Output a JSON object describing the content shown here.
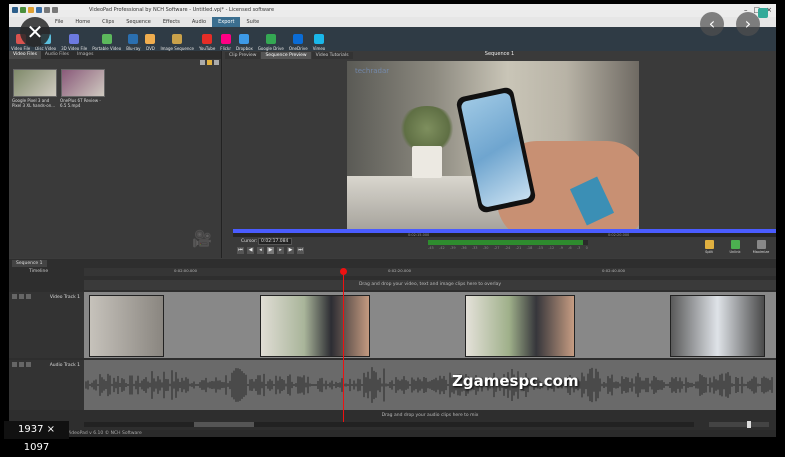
{
  "titlebar": {
    "title": "VideoPad Professional by NCH Software - Untitled.vpj* - Licensed software"
  },
  "menu": [
    "File",
    "Home",
    "Clips",
    "Sequence",
    "Effects",
    "Audio",
    "Export",
    "Suite"
  ],
  "menu_active_index": 6,
  "ribbon": [
    {
      "label": "Video File",
      "color": "#d9534f"
    },
    {
      "label": "Disc Video",
      "color": "#5bc0de"
    },
    {
      "label": "3D Video File",
      "color": "#6c7ae0"
    },
    {
      "label": "Portable Video",
      "color": "#5cb85c"
    },
    {
      "label": "Blu-ray",
      "color": "#2a6fb0"
    },
    {
      "label": "DVD",
      "color": "#f0ad4e"
    },
    {
      "label": "Image Sequence",
      "color": "#c9a14a"
    },
    {
      "label": "YouTube",
      "color": "#e52d27"
    },
    {
      "label": "Flickr",
      "color": "#ff0084"
    },
    {
      "label": "Dropbox",
      "color": "#3d9ae8"
    },
    {
      "label": "Google Drive",
      "color": "#34a853"
    },
    {
      "label": "OneDrive",
      "color": "#0a6cd6"
    },
    {
      "label": "Vimeo",
      "color": "#1ab7ea"
    }
  ],
  "nch_suite": "NCH Suite",
  "media": {
    "tabs": [
      "Video Files",
      "Audio Files",
      "Images"
    ],
    "clips": [
      {
        "label": "Google Pixel 3 and Pixel 3 XL hands-on...",
        "color": "#7f8a6a"
      },
      {
        "label": "OnePlus 6T Review - 6.5 5.mp4",
        "color": "#8a5a7a"
      }
    ]
  },
  "preview": {
    "tabs": [
      "Clip Preview",
      "Sequence Preview",
      "Video Tutorials"
    ],
    "sequence_title": "Sequence 1",
    "watermark": "techradar",
    "ruler_ticks": [
      "0:02:15.000",
      "0:02:20.000",
      "0:02:25.000"
    ],
    "cursor_label": "Cursor:",
    "cursor_value": "0:02:17.084",
    "meter_levels": [
      "-45",
      "-42",
      "-39",
      "-36",
      "-33",
      "-30",
      "-27",
      "-24",
      "-21",
      "-18",
      "-15",
      "-12",
      "-9",
      "-6",
      "-3",
      "0"
    ],
    "meter_fill": 0.97,
    "tools": [
      {
        "label": "Split",
        "color": "#e0b040"
      },
      {
        "label": "Unlink",
        "color": "#4caf50"
      },
      {
        "label": "Maximize",
        "color": "#888888"
      }
    ]
  },
  "timeline": {
    "sequence_tab": "Sequence 1",
    "label": "Timeline",
    "ticks": [
      "0:02:00.000",
      "0:02:20.000",
      "0:02:40.000"
    ],
    "overlay_hint": "Drag and drop your video, text and image clips here to overlay",
    "video_track": "Video Track 1",
    "audio_track": "Audio Track 1",
    "audio_hint": "Drag and drop your audio clips here to mix"
  },
  "statusbar": "VideoPad v 6.10 © NCH Software",
  "dims_badge": "1937 × 1097",
  "site_watermark": "Zgamespc.com"
}
